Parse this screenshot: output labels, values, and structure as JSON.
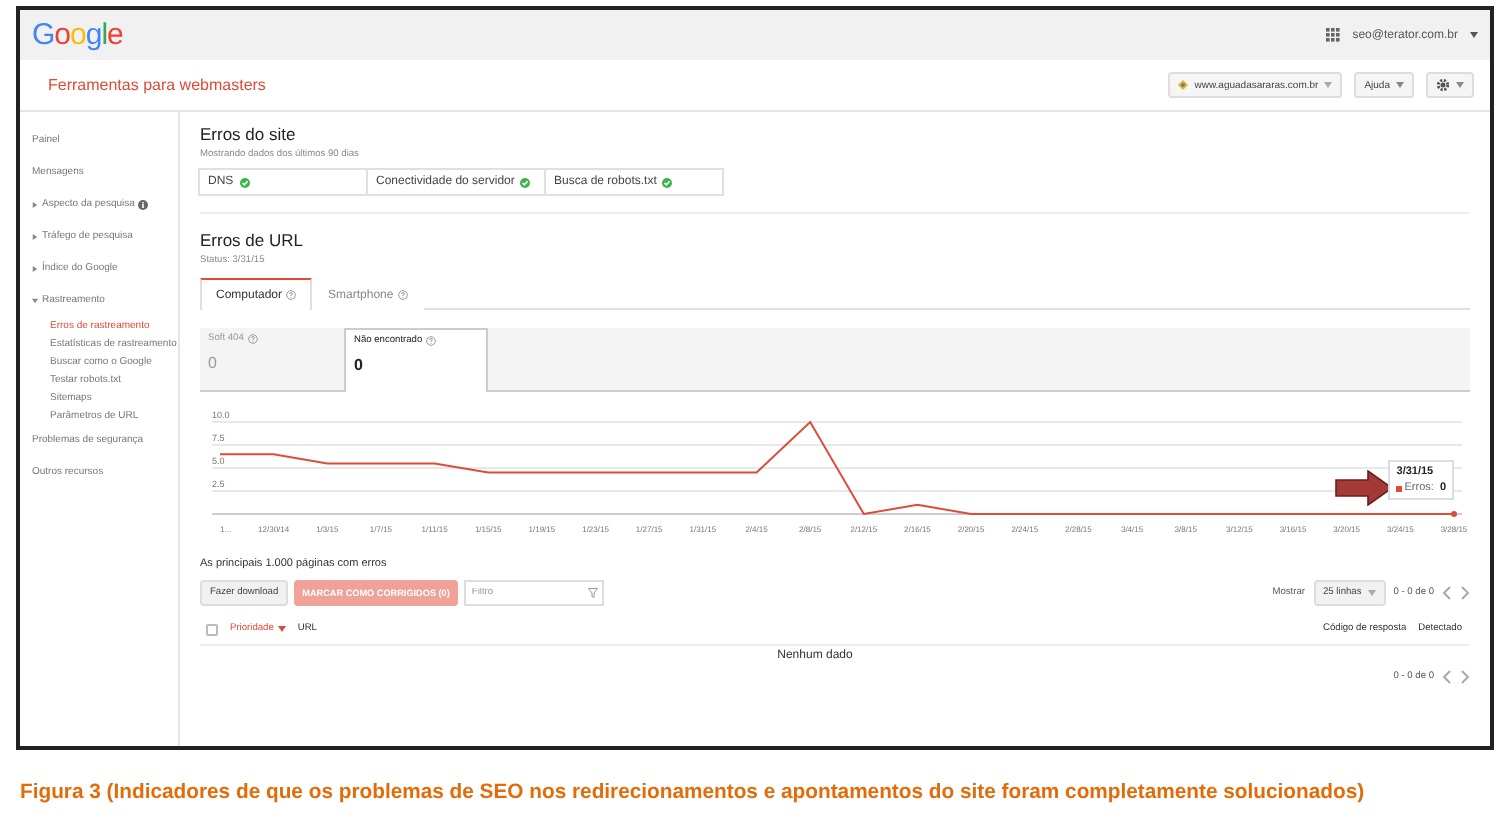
{
  "topbar": {
    "logo": "Google",
    "account": "seo@terator.com.br"
  },
  "header": {
    "title": "Ferramentas para webmasters",
    "site": "www.aguadasararas.com.br",
    "help": "Ajuda"
  },
  "sidebar": {
    "items": [
      {
        "label": "Painel",
        "kind": "link",
        "selected": false
      },
      {
        "label": "Mensagens",
        "kind": "link",
        "selected": false
      },
      {
        "label": "Aspecto da pesquisa",
        "kind": "section",
        "expanded": false,
        "info": true
      },
      {
        "label": "Tráfego de pesquisa",
        "kind": "section",
        "expanded": false,
        "info": false
      },
      {
        "label": "Índice do Google",
        "kind": "section",
        "expanded": false,
        "info": false
      },
      {
        "label": "Rastreamento",
        "kind": "section",
        "expanded": true,
        "info": false,
        "children": [
          {
            "label": "Erros de rastreamento",
            "selected": true
          },
          {
            "label": "Estatísticas de rastreamento",
            "selected": false
          },
          {
            "label": "Buscar como o Google",
            "selected": false
          },
          {
            "label": "Testar robots.txt",
            "selected": false
          },
          {
            "label": "Sitemaps",
            "selected": false
          },
          {
            "label": "Parâmetros de URL",
            "selected": false
          }
        ]
      },
      {
        "label": "Problemas de segurança",
        "kind": "link",
        "selected": false
      },
      {
        "label": "Outros recursos",
        "kind": "link",
        "selected": false
      }
    ]
  },
  "site_errors": {
    "title": "Erros do site",
    "subtitle": "Mostrando dados dos últimos 90 dias",
    "checks": [
      {
        "label": "DNS",
        "ok": true
      },
      {
        "label": "Conectividade do servidor",
        "ok": true
      },
      {
        "label": "Busca de robots.txt",
        "ok": true
      }
    ]
  },
  "url_errors": {
    "title": "Erros de URL",
    "status": "Status: 3/31/15",
    "tabs": [
      {
        "label": "Computador",
        "selected": true
      },
      {
        "label": "Smartphone",
        "selected": false
      }
    ],
    "counters": [
      {
        "label": "Soft 404",
        "value": "0",
        "selected": false
      },
      {
        "label": "Não encontrado",
        "value": "0",
        "selected": true
      }
    ],
    "chart_data": {
      "type": "line",
      "categories": [
        "1...",
        "12/30/14",
        "1/3/15",
        "1/7/15",
        "1/11/15",
        "1/15/15",
        "1/19/15",
        "1/23/15",
        "1/27/15",
        "1/31/15",
        "2/4/15",
        "2/8/15",
        "2/12/15",
        "2/16/15",
        "2/20/15",
        "2/24/15",
        "2/28/15",
        "3/4/15",
        "3/8/15",
        "3/12/15",
        "3/16/15",
        "3/20/15",
        "3/24/15",
        "3/28/15"
      ],
      "grid": true,
      "series": [
        {
          "name": "Erros:",
          "color": "#dd4b39",
          "values": [
            6.5,
            6.5,
            5.5,
            5.5,
            5.5,
            4.5,
            4.5,
            4.5,
            4.5,
            4.5,
            4.5,
            10,
            0,
            1,
            0,
            0,
            0,
            0,
            0,
            0,
            0,
            0,
            0,
            0
          ]
        }
      ],
      "ylim": [
        0,
        10
      ],
      "yticks": [
        {
          "value": 2.5,
          "label": "2.5"
        },
        {
          "value": 5,
          "label": "5.0"
        },
        {
          "value": 7.5,
          "label": "7.5"
        },
        {
          "value": 10,
          "label": "10.0"
        }
      ]
    },
    "tooltip": {
      "date": "3/31/15",
      "value": "0"
    },
    "select_all": {
      "checked": false
    },
    "table_title": "As principais 1.000 páginas com erros",
    "download": "Fazer download",
    "mark_fixed": {
      "label": "MARCAR COMO CORRIGIDOS (0)",
      "disabled": true
    },
    "filter": {
      "placeholder": "Filtro"
    },
    "show_label": "Mostrar",
    "rows_select": "25 linhas",
    "range": "0 - 0 de 0",
    "columns": [
      {
        "label": "Prioridade",
        "sorted": true
      },
      {
        "label": "URL",
        "sorted": false
      },
      {
        "label": "Código de resposta",
        "sorted": false
      },
      {
        "label": "Detectado",
        "sorted": false
      }
    ],
    "empty": "Nenhum dado",
    "footer_range": "0 - 0 de 0"
  },
  "caption": "Figura 3 (Indicadores de que os problemas de SEO nos redirecionamentos e apontamentos do site foram completamente solucionados)"
}
